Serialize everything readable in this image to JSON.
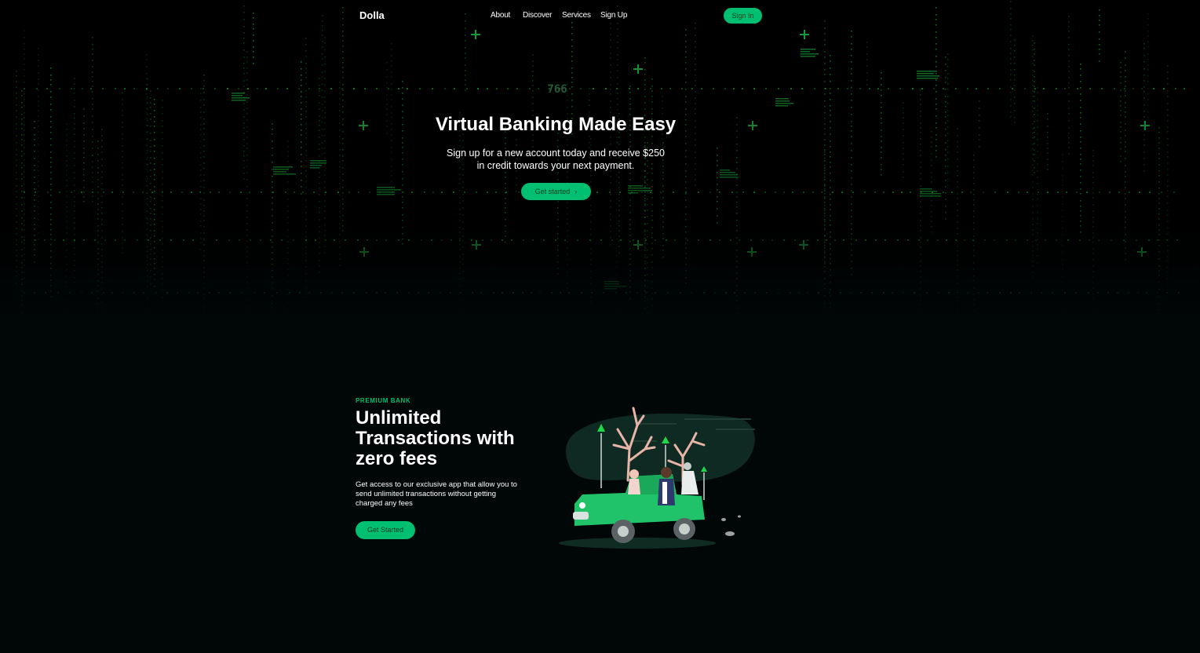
{
  "nav": {
    "logo": "Dolla",
    "links": [
      "About",
      "Discover",
      "Services",
      "Sign Up"
    ],
    "signin_label": "Sign In"
  },
  "hero": {
    "counter": "766",
    "title": "Virtual Banking Made Easy",
    "subtitle_line1": "Sign up for a new account today and receive $250",
    "subtitle_line2": "in credit towards your next payment.",
    "button_label": "Get started",
    "button_icon": "chevron-right-icon"
  },
  "info": {
    "top_line": "PREMIUM BANK",
    "heading_lines": [
      "Unlimited",
      "Transactions with",
      "zero fees"
    ],
    "subtitle_lines": [
      "Get access to our exclusive app that allow you to",
      "send unlimited transactions without getting",
      "charged any fees"
    ],
    "button_label": "Get Started",
    "illustration": "car-illustration"
  },
  "colors": {
    "accent": "#01bf71",
    "background": "#010606",
    "matrix_green": "#1fd84a"
  }
}
